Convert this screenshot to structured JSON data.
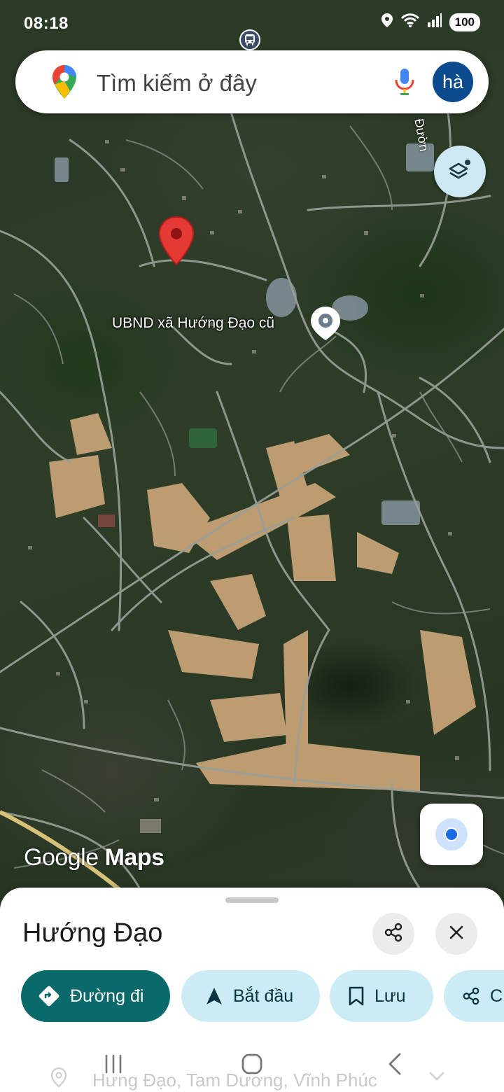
{
  "status_bar": {
    "time": "08:18",
    "battery": "100",
    "icons": [
      "location-icon",
      "wifi-icon",
      "signal-icon"
    ]
  },
  "search": {
    "placeholder": "Tìm kiếm ở đây",
    "avatar_initials": "hà"
  },
  "map": {
    "place_label": "UBND xã Hướng Đạo cũ",
    "road_label_partial": "Đườn",
    "watermark_google": "Google",
    "watermark_maps": "Maps"
  },
  "sheet": {
    "title": "Hướng Đạo",
    "chips": {
      "directions": "Đường đi",
      "start": "Bắt đầu",
      "save": "Lưu",
      "share_partial": "C"
    },
    "address": "Hưng Đạo, Tam Dương, Vĩnh Phúc"
  },
  "colors": {
    "directions_chip": "#0a6a6a",
    "secondary_chip": "#ccecf5",
    "marker_red": "#e53935",
    "avatar_bg": "#0b4a8c"
  }
}
